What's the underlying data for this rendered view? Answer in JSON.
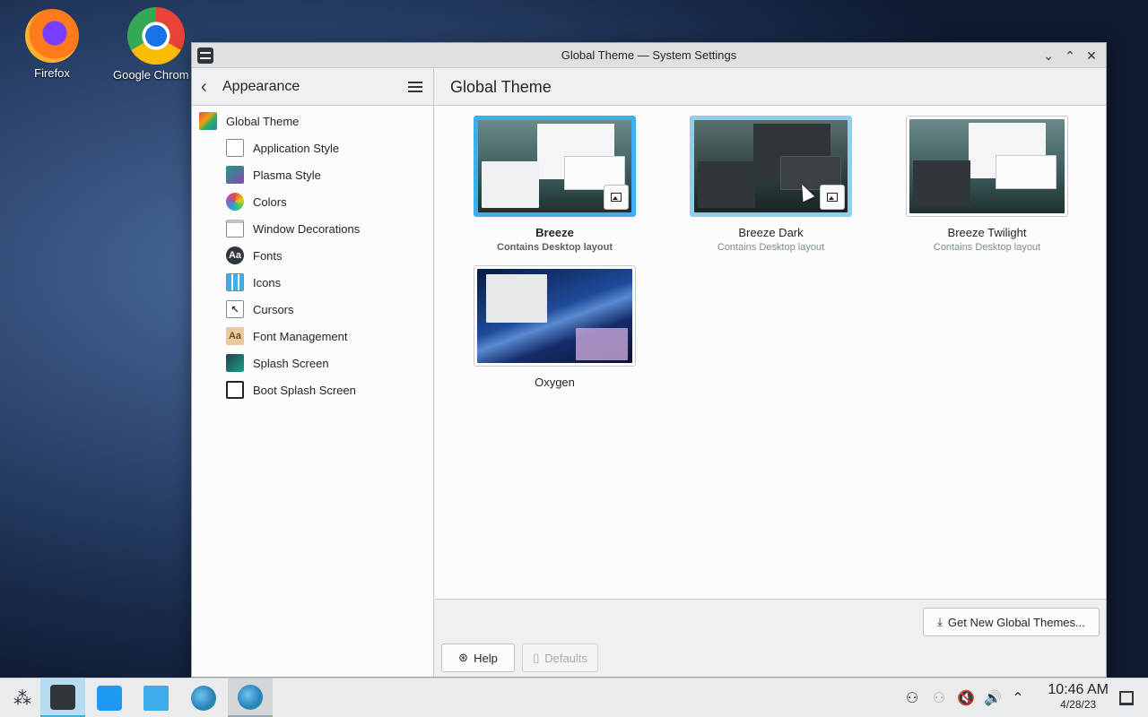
{
  "desktop": {
    "icons": [
      {
        "label": "Firefox"
      },
      {
        "label": "Google Chrom"
      }
    ]
  },
  "window": {
    "title": "Global Theme — System Settings",
    "controls": {
      "minimize": "⌄",
      "maximize": "⌃",
      "close": "✕"
    }
  },
  "sidebar": {
    "back_icon": "‹",
    "heading": "Appearance",
    "items": [
      {
        "label": "Global Theme",
        "icon": "global-theme-icon"
      },
      {
        "label": "Application Style",
        "icon": "application-style-icon"
      },
      {
        "label": "Plasma Style",
        "icon": "plasma-style-icon"
      },
      {
        "label": "Colors",
        "icon": "colors-icon"
      },
      {
        "label": "Window Decorations",
        "icon": "window-decorations-icon"
      },
      {
        "label": "Fonts",
        "icon": "fonts-icon",
        "glyph": "Aa"
      },
      {
        "label": "Icons",
        "icon": "icons-icon"
      },
      {
        "label": "Cursors",
        "icon": "cursors-icon",
        "glyph": "↖"
      },
      {
        "label": "Font Management",
        "icon": "font-management-icon",
        "glyph": "Aa"
      },
      {
        "label": "Splash Screen",
        "icon": "splash-screen-icon"
      },
      {
        "label": "Boot Splash Screen",
        "icon": "boot-splash-screen-icon"
      }
    ]
  },
  "main": {
    "title": "Global Theme",
    "themes": [
      {
        "name": "Breeze",
        "subtitle": "Contains Desktop layout",
        "selected": true
      },
      {
        "name": "Breeze Dark",
        "subtitle": "Contains Desktop layout",
        "selected": false
      },
      {
        "name": "Breeze Twilight",
        "subtitle": "Contains Desktop layout",
        "selected": false
      },
      {
        "name": "Oxygen",
        "subtitle": "",
        "selected": false
      }
    ],
    "get_new_button": "Get New Global Themes...",
    "help_button": "Help",
    "defaults_button": "Defaults"
  },
  "taskbar": {
    "clock_time": "10:46 AM",
    "clock_date": "4/28/23"
  },
  "colors": {
    "accent": "#3daee9",
    "window_bg": "#eff0f1",
    "view_bg": "#fcfcfc"
  }
}
